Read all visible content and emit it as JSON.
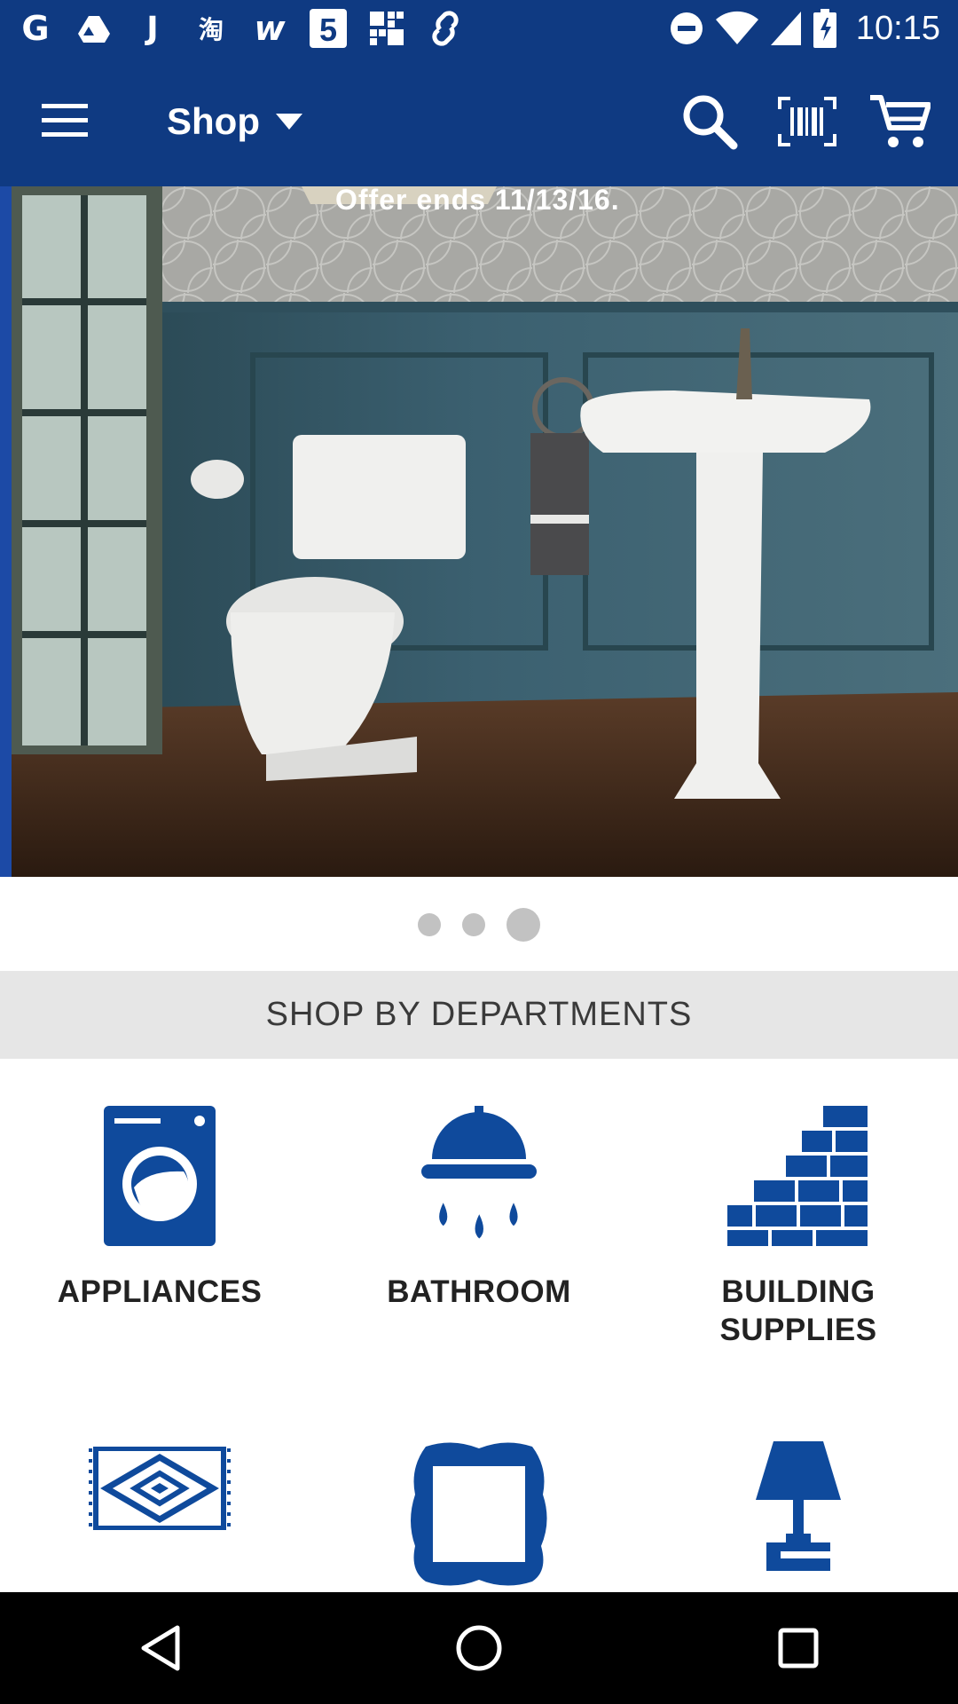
{
  "status_bar": {
    "time": "10:15",
    "left_icons": [
      "google-icon",
      "drive-icon",
      "j-icon",
      "taobao-icon",
      "w-icon",
      "five-icon",
      "grid-icon",
      "link-icon"
    ],
    "right_icons": [
      "do-not-disturb-icon",
      "wifi-icon",
      "signal-icon",
      "battery-icon"
    ]
  },
  "app_bar": {
    "title": "Shop",
    "bg_color": "#0f3a82"
  },
  "banner": {
    "offer_text": "Offer ends 11/13/16.",
    "dots_count": 3,
    "active_dot": 3
  },
  "departments": {
    "section_title": "SHOP BY DEPARTMENTS",
    "accent_color": "#0f4a9c",
    "items": [
      {
        "label": "APPLIANCES",
        "icon": "washer-icon"
      },
      {
        "label": "BATHROOM",
        "icon": "shower-icon"
      },
      {
        "label": "BUILDING\nSUPPLIES",
        "icon": "bricks-icon"
      },
      {
        "label": "",
        "icon": "rug-icon"
      },
      {
        "label": "",
        "icon": "frame-icon"
      },
      {
        "label": "",
        "icon": "lamp-icon"
      }
    ]
  },
  "nav_bar": {
    "buttons": [
      "back-icon",
      "home-icon",
      "recents-icon"
    ]
  }
}
